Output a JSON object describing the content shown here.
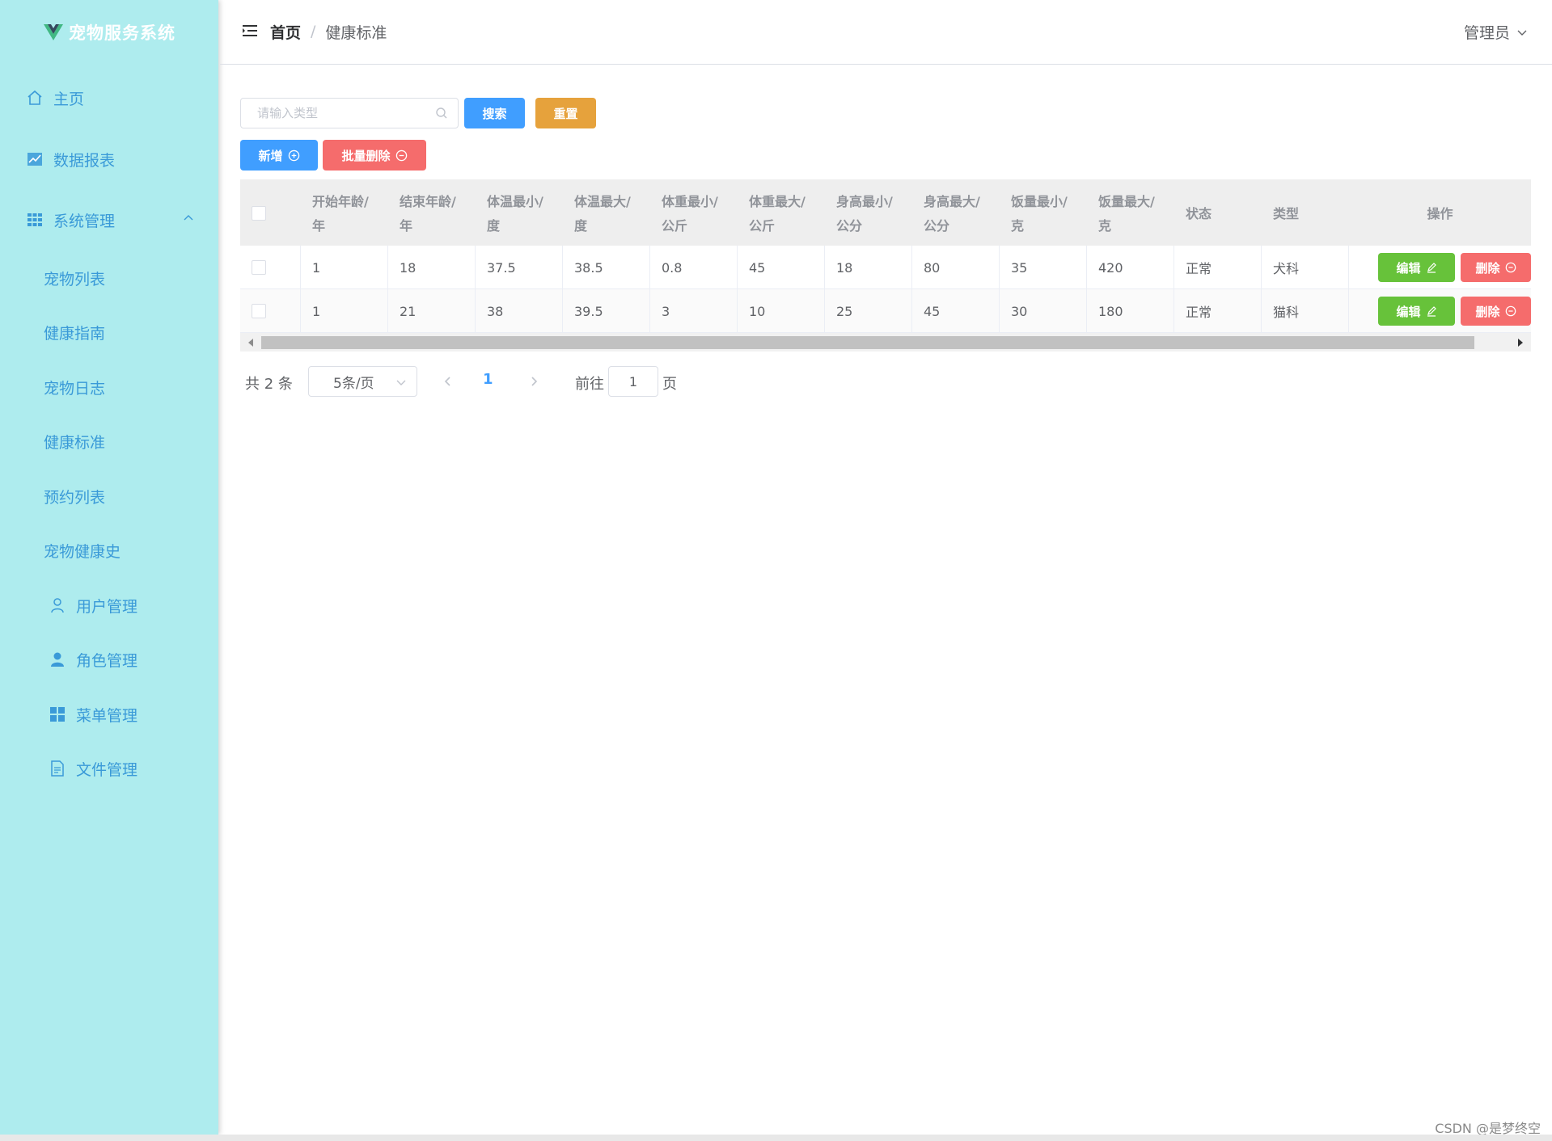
{
  "app": {
    "title": "宠物服务系统"
  },
  "colors": {
    "sidebar_bg": "#aeecee",
    "menu_text": "#3a9ad8",
    "primary": "#409eff",
    "success": "#67c23a",
    "warning": "#e6a23c",
    "danger": "#f56c6c"
  },
  "sidebar": {
    "items": [
      {
        "label": "主页",
        "icon": "home-icon"
      },
      {
        "label": "数据报表",
        "icon": "chart-icon"
      },
      {
        "label": "系统管理",
        "icon": "grid-icon",
        "expanded": true
      }
    ],
    "sub_items": [
      {
        "label": "宠物列表"
      },
      {
        "label": "健康指南"
      },
      {
        "label": "宠物日志"
      },
      {
        "label": "健康标准"
      },
      {
        "label": "预约列表"
      },
      {
        "label": "宠物健康史"
      },
      {
        "label": "用户管理",
        "icon": "user-icon"
      },
      {
        "label": "角色管理",
        "icon": "person-icon"
      },
      {
        "label": "菜单管理",
        "icon": "menu-grid-icon"
      },
      {
        "label": "文件管理",
        "icon": "document-icon"
      }
    ]
  },
  "header": {
    "breadcrumb": {
      "home": "首页",
      "separator": "/",
      "current": "健康标准"
    },
    "user": "管理员"
  },
  "toolbar": {
    "search_placeholder": "请输入类型",
    "search_label": "搜索",
    "reset_label": "重置",
    "add_label": "新增",
    "batch_delete_label": "批量删除"
  },
  "table": {
    "columns": [
      {
        "line1": "开始年龄/",
        "line2": "年"
      },
      {
        "line1": "结束年龄/",
        "line2": "年"
      },
      {
        "line1": "体温最小/",
        "line2": "度"
      },
      {
        "line1": "体温最大/",
        "line2": "度"
      },
      {
        "line1": "体重最小/",
        "line2": "公斤"
      },
      {
        "line1": "体重最大/",
        "line2": "公斤"
      },
      {
        "line1": "身高最小/",
        "line2": "公分"
      },
      {
        "line1": "身高最大/",
        "line2": "公分"
      },
      {
        "line1": "饭量最小/",
        "line2": "克"
      },
      {
        "line1": "饭量最大/",
        "line2": "克"
      },
      {
        "line1": "状态",
        "line2": ""
      },
      {
        "line1": "类型",
        "line2": ""
      },
      {
        "line1": "操作",
        "line2": ""
      }
    ],
    "rows": [
      {
        "cells": [
          "1",
          "18",
          "37.5",
          "38.5",
          "0.8",
          "45",
          "18",
          "80",
          "35",
          "420",
          "正常",
          "犬科"
        ]
      },
      {
        "cells": [
          "1",
          "21",
          "38",
          "39.5",
          "3",
          "10",
          "25",
          "45",
          "30",
          "180",
          "正常",
          "猫科"
        ]
      }
    ],
    "edit_label": "编辑",
    "delete_label": "删除"
  },
  "pagination": {
    "total": "共 2 条",
    "page_size": "5条/页",
    "current_page": "1",
    "goto_label": "前往",
    "goto_value": "1",
    "page_unit": "页"
  },
  "watermark": "CSDN @是梦终空"
}
